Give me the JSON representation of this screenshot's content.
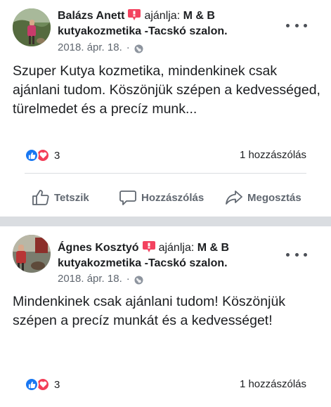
{
  "posts": [
    {
      "author": "Balázs Anett",
      "recommends_word": "ajánlja:",
      "page_name_line1": "M & B",
      "page_name_line2": "kutyakozmetika -Tacskó szalon.",
      "date": "2018. ápr. 18.",
      "separator": "·",
      "text": "Szuper Kutya kozmetika, mindenkinek csak ajánlani tudom. Köszönjük szépen a kedvességed, türelmedet és a precíz munk...",
      "reaction_count": "3",
      "comments": "1 hozzászólás"
    },
    {
      "author": "Ágnes Kosztyó",
      "recommends_word": "ajánlja:",
      "page_name_line1": "M & B",
      "page_name_line2": "kutyakozmetika -Tacskó szalon.",
      "date": "2018. ápr. 18.",
      "separator": "·",
      "text": "Mindenkinek csak ajánlani tudom! Köszönjük szépen a precíz munkát és a kedvességet!",
      "reaction_count": "3",
      "comments": "1 hozzászólás"
    }
  ],
  "actions": {
    "like": "Tetszik",
    "comment": "Hozzászólás",
    "share": "Megosztás"
  },
  "icons": {
    "recommend": "recommend-badge-icon",
    "globe": "globe-icon",
    "more": "more-options-icon",
    "like_reaction": "like-reaction-icon",
    "love_reaction": "love-reaction-icon"
  },
  "colors": {
    "like_blue": "#1877f2",
    "love_red": "#f33e58",
    "recommend_red": "#f3425f",
    "meta_gray": "#606770",
    "separator_gray": "#dadde1"
  }
}
